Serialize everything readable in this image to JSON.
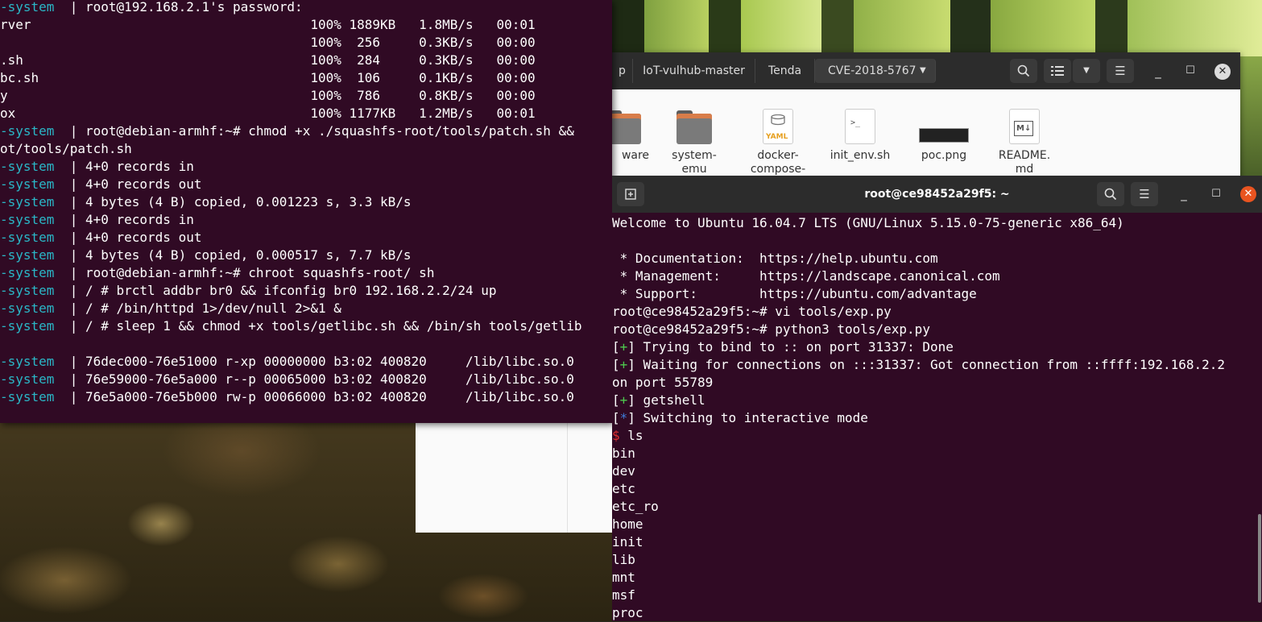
{
  "file_manager": {
    "breadcrumbs": [
      "p",
      "IoT-vulhub-master",
      "Tenda",
      "CVE-2018-5767"
    ],
    "search_icon": "search-icon",
    "view_icon": "list-view-icon",
    "view_menu_icon": "chevron-down-icon",
    "menu_icon": "hamburger-icon",
    "files": [
      {
        "name": "ware",
        "icon": "folder"
      },
      {
        "name": "system-emu",
        "line1": "system-",
        "line2": "emu",
        "icon": "folder"
      },
      {
        "name": "docker-compose-",
        "line1": "docker-",
        "line2": "compose-",
        "icon": "yaml",
        "badge": "YAML"
      },
      {
        "name": "init_env.sh",
        "icon": "script",
        "badge": ">_"
      },
      {
        "name": "poc.png",
        "icon": "image"
      },
      {
        "name": "README.md",
        "line1": "README.",
        "line2": "md",
        "icon": "markdown",
        "badge": "M↓"
      }
    ]
  },
  "left_terminal": {
    "lines": [
      {
        "p": "-system  | ",
        "t": "root@192.168.2.1's password:"
      },
      {
        "p": "",
        "t": "rver                                    100% 1889KB   1.8MB/s   00:01"
      },
      {
        "p": "",
        "t": "                                        100%  256     0.3KB/s   00:00"
      },
      {
        "p": "",
        "t": ".sh                                     100%  284     0.3KB/s   00:00"
      },
      {
        "p": "",
        "t": "bc.sh                                   100%  106     0.1KB/s   00:00"
      },
      {
        "p": "",
        "t": "y                                       100%  786     0.8KB/s   00:00"
      },
      {
        "p": "",
        "t": "ox                                      100% 1177KB   1.2MB/s   00:01"
      },
      {
        "p": "-system  | ",
        "t": "root@debian-armhf:~# chmod +x ./squashfs-root/tools/patch.sh &&"
      },
      {
        "p": "",
        "t": "ot/tools/patch.sh"
      },
      {
        "p": "-system  | ",
        "t": "4+0 records in"
      },
      {
        "p": "-system  | ",
        "t": "4+0 records out"
      },
      {
        "p": "-system  | ",
        "t": "4 bytes (4 B) copied, 0.001223 s, 3.3 kB/s"
      },
      {
        "p": "-system  | ",
        "t": "4+0 records in"
      },
      {
        "p": "-system  | ",
        "t": "4+0 records out"
      },
      {
        "p": "-system  | ",
        "t": "4 bytes (4 B) copied, 0.000517 s, 7.7 kB/s"
      },
      {
        "p": "-system  | ",
        "t": "root@debian-armhf:~# chroot squashfs-root/ sh"
      },
      {
        "p": "-system  | ",
        "t": "/ # brctl addbr br0 && ifconfig br0 192.168.2.2/24 up"
      },
      {
        "p": "-system  | ",
        "t": "/ # /bin/httpd 1>/dev/null 2>&1 &"
      },
      {
        "p": "-system  | ",
        "t": "/ # sleep 1 && chmod +x tools/getlibc.sh && /bin/sh tools/getlib"
      },
      {
        "p": "",
        "t": ""
      },
      {
        "p": "-system  | ",
        "t": "76dec000-76e51000 r-xp 00000000 b3:02 400820     /lib/libc.so.0"
      },
      {
        "p": "-system  | ",
        "t": "76e59000-76e5a000 r--p 00065000 b3:02 400820     /lib/libc.so.0"
      },
      {
        "p": "-system  | ",
        "t": "76e5a000-76e5b000 rw-p 00066000 b3:02 400820     /lib/libc.so.0"
      }
    ]
  },
  "right_terminal": {
    "title": "root@ce98452a29f5: ~",
    "new_tab_icon": "new-tab-icon",
    "lines": [
      {
        "t": "Welcome to Ubuntu 16.04.7 LTS (GNU/Linux 5.15.0-75-generic x86_64)"
      },
      {
        "t": ""
      },
      {
        "t": " * Documentation:  https://help.ubuntu.com"
      },
      {
        "t": " * Management:     https://landscape.canonical.com"
      },
      {
        "t": " * Support:        https://ubuntu.com/advantage"
      },
      {
        "t": "root@ce98452a29f5:~# vi tools/exp.py"
      },
      {
        "t": "root@ce98452a29f5:~# python3 tools/exp.py"
      },
      {
        "mark": "+",
        "mc": "g",
        "t": " Trying to bind to :: on port 31337: Done"
      },
      {
        "mark": "+",
        "mc": "g",
        "t": " Waiting for connections on :::31337: Got connection from ::ffff:192.168.2.2"
      },
      {
        "t": "on port 55789"
      },
      {
        "mark": "+",
        "mc": "g",
        "t": " getshell"
      },
      {
        "mark": "*",
        "mc": "b",
        "t": " Switching to interactive mode"
      },
      {
        "dollar": "$",
        "t": " ls"
      },
      {
        "t": "bin"
      },
      {
        "t": "dev"
      },
      {
        "t": "etc"
      },
      {
        "t": "etc_ro"
      },
      {
        "t": "home"
      },
      {
        "t": "init"
      },
      {
        "t": "lib"
      },
      {
        "t": "mnt"
      },
      {
        "t": "msf"
      },
      {
        "t": "proc"
      }
    ]
  },
  "colors": {
    "terminal_bg": "#300a24",
    "prefix_cyan": "#2ab7c7",
    "ok_green": "#4ec94e",
    "info_blue": "#3e7bd8",
    "prompt_red": "#e03030",
    "close_orange": "#e95420"
  }
}
